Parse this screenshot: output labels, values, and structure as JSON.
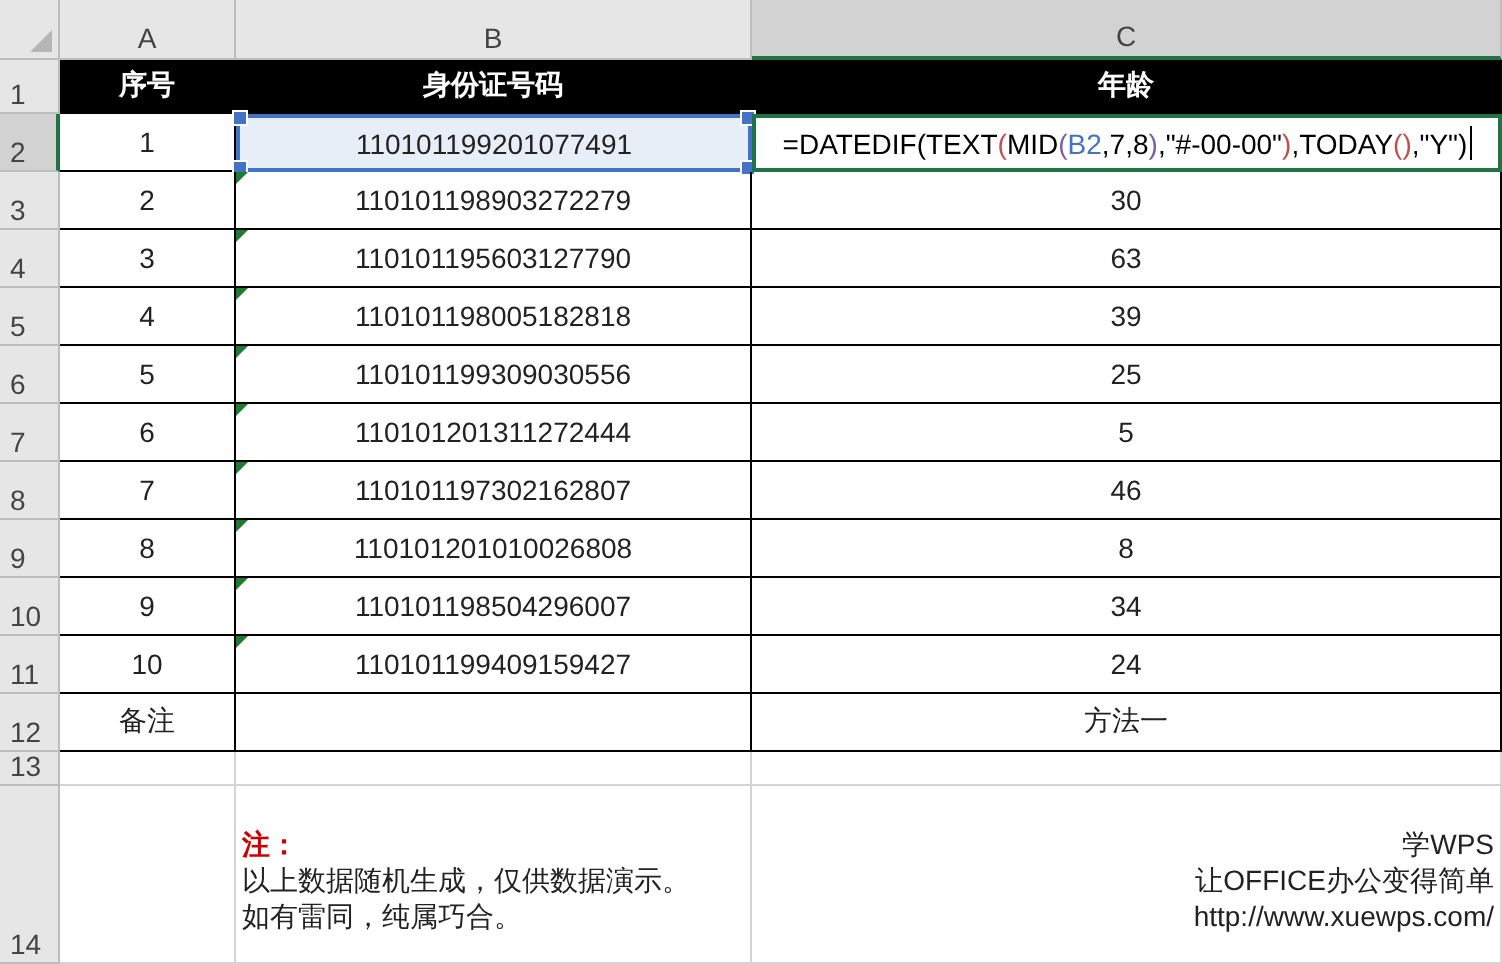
{
  "columns": [
    {
      "label": "A",
      "selected": false
    },
    {
      "label": "B",
      "selected": false
    },
    {
      "label": "C",
      "selected": true
    }
  ],
  "header_row": {
    "number": "1",
    "cells": [
      "序号",
      "身份证号码",
      "年龄"
    ]
  },
  "rows": [
    {
      "number": "2",
      "selected": true,
      "no": "1",
      "id": "110101199201077491",
      "id_flag": false,
      "id_selected": true,
      "age_formula": [
        {
          "text": "=DATEDIF(TEXT",
          "color": "#000000"
        },
        {
          "text": "(",
          "color": "#c0504d"
        },
        {
          "text": "MID",
          "color": "#000000"
        },
        {
          "text": "(",
          "color": "#7b5ea7"
        },
        {
          "text": "B2",
          "color": "#4472c4"
        },
        {
          "text": ",7,8",
          "color": "#000000"
        },
        {
          "text": ")",
          "color": "#7b5ea7"
        },
        {
          "text": ",\"#-00-00\"",
          "color": "#000000"
        },
        {
          "text": ")",
          "color": "#c0504d"
        },
        {
          "text": ",TODAY",
          "color": "#000000"
        },
        {
          "text": "()",
          "color": "#c0504d"
        },
        {
          "text": ",\"Y\"",
          "color": "#000000"
        },
        {
          "text": ")",
          "color": "#000000"
        }
      ]
    },
    {
      "number": "3",
      "selected": false,
      "no": "2",
      "id": "110101198903272279",
      "id_flag": true,
      "id_selected": false,
      "age": "30"
    },
    {
      "number": "4",
      "selected": false,
      "no": "3",
      "id": "110101195603127790",
      "id_flag": true,
      "id_selected": false,
      "age": "63"
    },
    {
      "number": "5",
      "selected": false,
      "no": "4",
      "id": "110101198005182818",
      "id_flag": true,
      "id_selected": false,
      "age": "39"
    },
    {
      "number": "6",
      "selected": false,
      "no": "5",
      "id": "110101199309030556",
      "id_flag": true,
      "id_selected": false,
      "age": "25"
    },
    {
      "number": "7",
      "selected": false,
      "no": "6",
      "id": "110101201311272444",
      "id_flag": true,
      "id_selected": false,
      "age": "5"
    },
    {
      "number": "8",
      "selected": false,
      "no": "7",
      "id": "110101197302162807",
      "id_flag": true,
      "id_selected": false,
      "age": "46"
    },
    {
      "number": "9",
      "selected": false,
      "no": "8",
      "id": "110101201010026808",
      "id_flag": true,
      "id_selected": false,
      "age": "8"
    },
    {
      "number": "10",
      "selected": false,
      "no": "9",
      "id": "110101198504296007",
      "id_flag": true,
      "id_selected": false,
      "age": "34"
    },
    {
      "number": "11",
      "selected": false,
      "no": "10",
      "id": "110101199409159427",
      "id_flag": true,
      "id_selected": false,
      "age": "24"
    }
  ],
  "remark_row": {
    "number": "12",
    "label": "备注",
    "method": "方法一"
  },
  "blank_row": {
    "number": "13"
  },
  "note_row": {
    "number": "14",
    "note_title": "注：",
    "note_lines": [
      "以上数据随机生成，仅供数据演示。",
      "如有雷同，纯属巧合。"
    ],
    "credit_lines": [
      "学WPS",
      "让OFFICE办公变得简单",
      "http://www.xuewps.com/"
    ]
  }
}
